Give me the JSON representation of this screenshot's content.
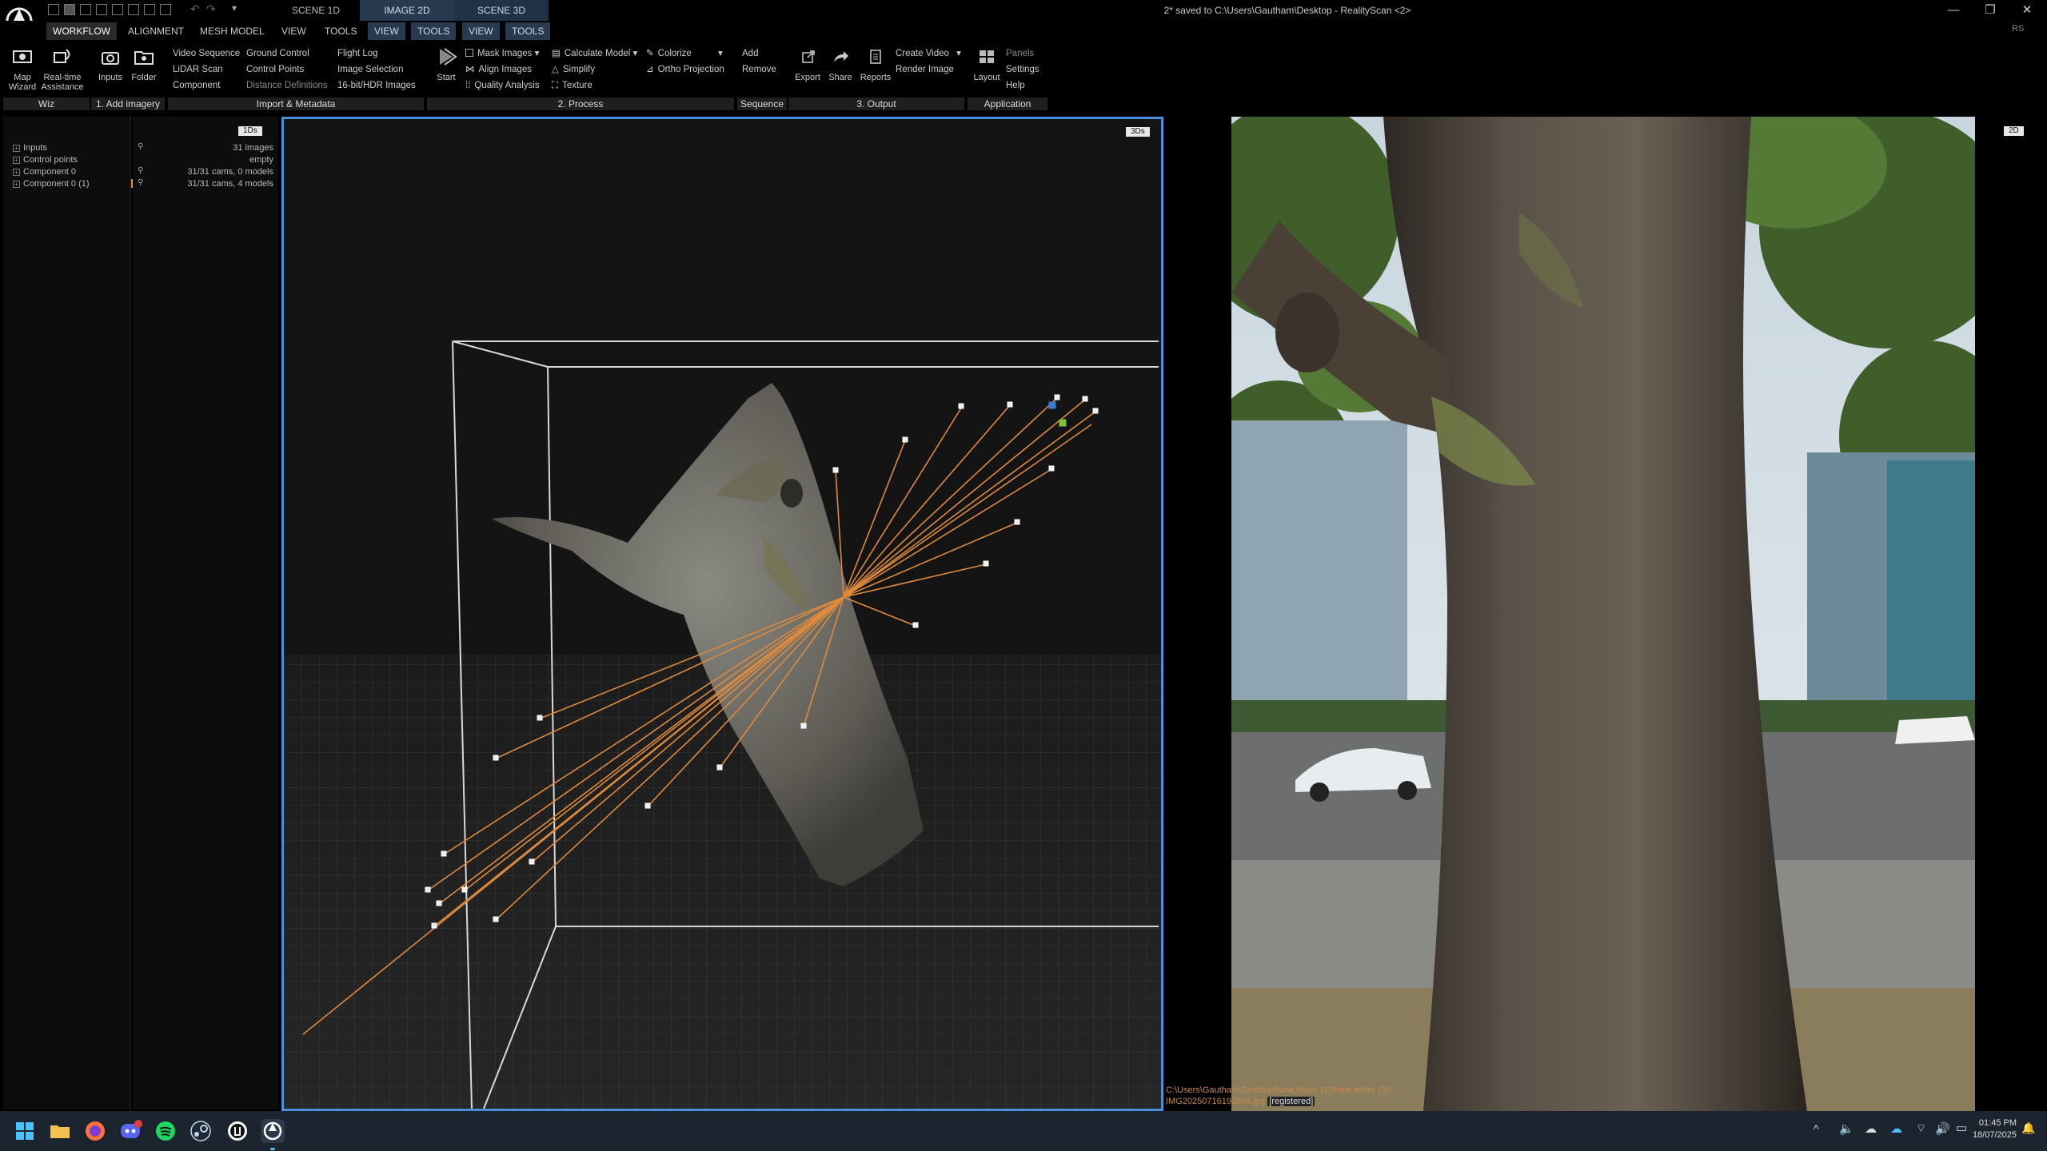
{
  "window": {
    "title": "2* saved to C:\\Users\\Gautham\\Desktop - RealityScan <2>",
    "view_tabs": [
      "SCENE 1D",
      "IMAGE 2D",
      "SCENE 3D"
    ],
    "badge": "RS"
  },
  "ribbon_tabs": [
    "WORKFLOW",
    "ALIGNMENT",
    "MESH MODEL",
    "VIEW",
    "TOOLS",
    "VIEW",
    "TOOLS",
    "VIEW",
    "TOOLS"
  ],
  "ribbon": {
    "wiz": {
      "map_wizard": "Map Wizard",
      "realtime": "Real-time Assistance",
      "group": "Wiz"
    },
    "add_imagery": {
      "inputs": "Inputs",
      "folder": "Folder",
      "group": "1. Add imagery"
    },
    "import": {
      "col1": [
        "Video Sequence",
        "LiDAR Scan",
        "Component"
      ],
      "col2": [
        "Ground Control",
        "Control Points",
        "Distance Definitions"
      ],
      "col3": [
        "Flight Log",
        "Image Selection",
        "16-bit/HDR Images"
      ],
      "group": "Import & Metadata"
    },
    "process": {
      "start": "Start",
      "col1": [
        "Mask Images",
        "Align Images",
        "Quality Analysis"
      ],
      "col2": [
        "Calculate Model",
        "Simplify",
        "Texture"
      ],
      "col3": [
        "Colorize",
        "Ortho Projection"
      ],
      "group": "2. Process"
    },
    "sequence": {
      "items": [
        "Add",
        "Remove"
      ],
      "group": "Sequence"
    },
    "output": {
      "export": "Export",
      "share": "Share",
      "reports": "Reports",
      "col": [
        "Create Video",
        "Render Image"
      ],
      "group": "3. Output"
    },
    "application": {
      "layout": "Layout",
      "col": [
        "Panels",
        "Settings",
        "Help"
      ],
      "group": "Application"
    }
  },
  "panels": {
    "tree_tag": "1Ds",
    "tree": [
      {
        "label": "Inputs",
        "value": "31 images"
      },
      {
        "label": "Control points",
        "value": "empty"
      },
      {
        "label": "Component 0",
        "value": "31/31 cams, 0 models"
      },
      {
        "label": "Component 0 (1)",
        "value": "31/31 cams, 4 models"
      }
    ]
  },
  "view3d": {
    "tag": "3Ds"
  },
  "view2d": {
    "tag": "2D",
    "path": "C:\\Users\\Gautham\\Desktop\\New folder (2)\\New folder (3)\\",
    "file": "IMG20250716193855.jpg",
    "status": "[registered]"
  },
  "taskbar": {
    "time": "01:45 PM",
    "date": "18/07/2025",
    "apps": [
      "start-icon",
      "explorer-icon",
      "firefox-icon",
      "discord-icon",
      "spotify-icon",
      "steam-icon",
      "unreal-icon",
      "realityscan-icon"
    ]
  },
  "colors": {
    "accent": "#4a8fd9",
    "camera_ray": "#e08a3c",
    "taskbar": "#1c2430"
  }
}
